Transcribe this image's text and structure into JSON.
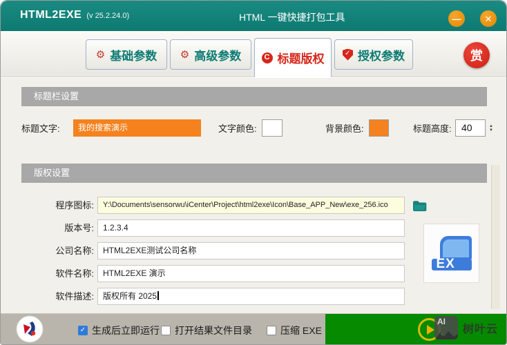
{
  "window": {
    "app_title": "HTML2EXE",
    "app_version": "(v 25.2.24.0)",
    "title_center": "HTML 一键快捷打包工具",
    "minimize_glyph": "—",
    "close_glyph": "✕"
  },
  "tabs": [
    {
      "label": "基础参数",
      "icon": "gear-icon",
      "active": false
    },
    {
      "label": "高级参数",
      "icon": "gear-icon",
      "active": false
    },
    {
      "label": "标题版权",
      "icon": "copyright-icon",
      "active": true
    },
    {
      "label": "授权参数",
      "icon": "shield-check-icon",
      "active": false
    }
  ],
  "reward_button": "赏",
  "title_section": {
    "header": "标题栏设置",
    "title_text_label": "标题文字:",
    "title_text_value": "我的搜索演示",
    "text_color_label": "文字颜色:",
    "text_color_value": "#FFFFFF",
    "bg_color_label": "背景颜色:",
    "bg_color_value": "#F5821F",
    "height_label": "标题高度:",
    "height_value": "40"
  },
  "copyright_section": {
    "header": "版权设置",
    "rows": [
      {
        "label": "程序图标:",
        "value": "Y:\\Documents\\sensorwu\\iCenter\\Project\\html2exe\\Icon\\Base_APP_New\\exe_256.ico"
      },
      {
        "label": "版本号:",
        "value": "1.2.3.4"
      },
      {
        "label": "公司名称:",
        "value": "HTML2EXE测试公司名称"
      },
      {
        "label": "软件名称:",
        "value": "HTML2EXE 演示"
      },
      {
        "label": "软件描述:",
        "value": "版权所有 2025"
      }
    ],
    "icon_preview_text": "EX"
  },
  "footer": {
    "checkboxes": [
      {
        "label": "生成后立即运行",
        "checked": true
      },
      {
        "label": "打开结果文件目录",
        "checked": false
      },
      {
        "label": "压缩 EXE",
        "checked": false
      }
    ],
    "watermark_ai": "AI",
    "watermark_text": "树叶云"
  },
  "colors": {
    "titlebar_teal": "#14837B",
    "tab_text_teal": "#0E7C74",
    "active_tab_red": "#D8261A",
    "accent_orange": "#F5821F",
    "window_button_orange": "#EE9414",
    "section_header_gray": "#A8A8A8",
    "content_bg": "#F2F0EA",
    "footer_bg": "#B9B5AC",
    "run_green": "#058A00",
    "checkbox_blue": "#2F7BD9",
    "icon_blue": "#3E7CDC",
    "path_input_yellow": "#FCFCDE"
  }
}
